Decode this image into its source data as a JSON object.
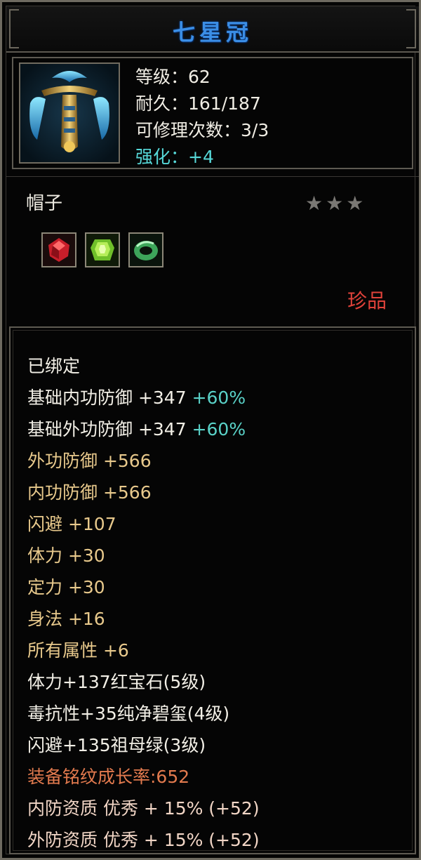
{
  "title": "七星冠",
  "item": {
    "icon_name": "crown-helmet-icon",
    "level": "等级：62",
    "durability": "耐久：161/187",
    "repair_count": "可修理次数：3/3",
    "enhance_label": "强化：",
    "enhance_value": "+4"
  },
  "type_label": "帽子",
  "stars": "★★★",
  "gems": [
    "ruby-gem-icon",
    "peridot-gem-icon",
    "jade-ring-gem-icon"
  ],
  "rarity": "珍品",
  "attributes": {
    "bound": "已绑定",
    "base_inner_def": "基础内功防御 +347",
    "base_inner_def_pct": "+60%",
    "base_outer_def": "基础外功防御 +347",
    "base_outer_def_pct": "+60%",
    "outer_def": "外功防御 +566",
    "inner_def": "内功防御 +566",
    "dodge": "闪避 +107",
    "stamina": "体力 +30",
    "focus": "定力 +30",
    "agility": "身法 +16",
    "all_attr": "所有属性 +6",
    "gem1": "体力+137红宝石(5级)",
    "gem2": "毒抗性+35纯净碧玺(4级)",
    "gem3": "闪避+135祖母绿(3级)",
    "inscription": "装备铭纹成长率:652",
    "inner_quality": "内防资质 优秀 + 15% (+52)",
    "outer_quality": "外防资质 优秀 + 15% (+52)"
  },
  "colors": {
    "title": "#3b8ee6",
    "cyan": "#56d8d8",
    "gold": "#e8c98c",
    "rarity": "#e0423a",
    "orange": "#e27a4e"
  }
}
